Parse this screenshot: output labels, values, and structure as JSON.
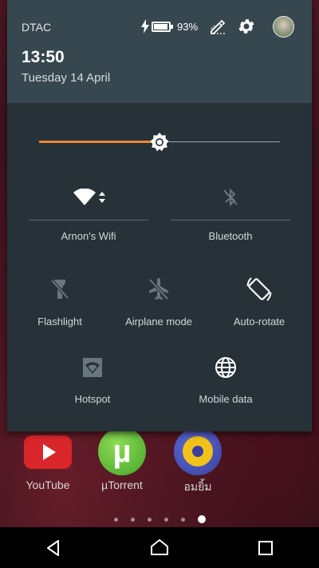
{
  "status": {
    "carrier": "DTAC",
    "battery_percent": "93%",
    "battery_level": 0.93,
    "time": "13:50",
    "date": "Tuesday 14 April"
  },
  "brightness": {
    "level": 0.5
  },
  "tiles": {
    "wifi": {
      "label": "Arnon's Wifi",
      "icon": "wifi-icon"
    },
    "bluetooth": {
      "label": "Bluetooth",
      "icon": "bluetooth-off-icon"
    },
    "flashlight": {
      "label": "Flashlight",
      "icon": "flashlight-off-icon"
    },
    "airplane": {
      "label": "Airplane mode",
      "icon": "airplane-off-icon"
    },
    "autorotate": {
      "label": "Auto-rotate",
      "icon": "rotate-icon"
    },
    "hotspot": {
      "label": "Hotspot",
      "icon": "hotspot-icon"
    },
    "mobile_data": {
      "label": "Mobile data",
      "icon": "globe-icon"
    }
  },
  "home": {
    "apps": [
      {
        "label": "YouTube",
        "icon": "youtube-icon"
      },
      {
        "label": "µTorrent",
        "icon": "utorrent-icon"
      },
      {
        "label": "อมยิ้ม",
        "icon": "om-app-icon"
      }
    ],
    "page_count": 6,
    "current_page": 6
  },
  "colors": {
    "accent": "#ef8733",
    "shade_bg": "#263238",
    "header_bg": "#37474f"
  }
}
